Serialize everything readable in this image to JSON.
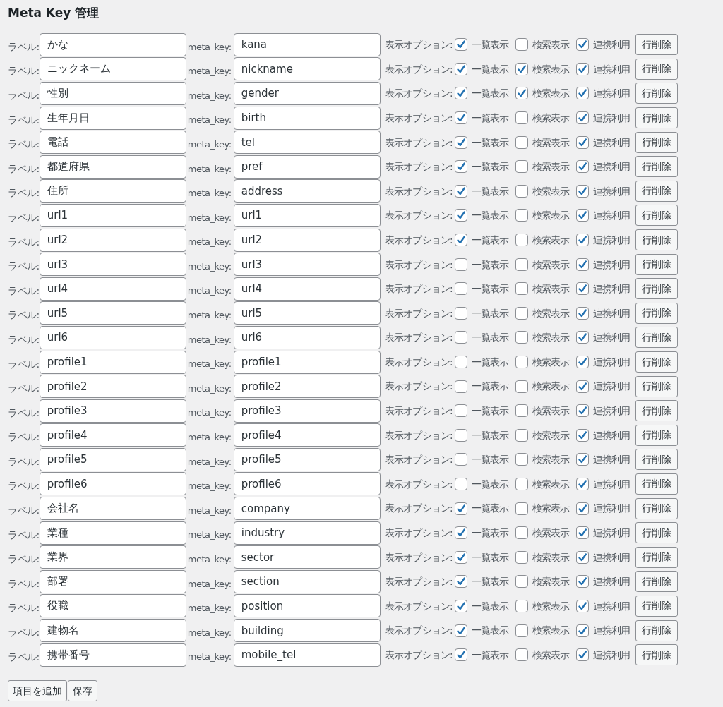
{
  "title": "Meta Key 管理",
  "rows": [
    {
      "label_caption": "ラベル:",
      "label": "かな",
      "key_caption": "meta_key:",
      "key": "kana",
      "options_caption": "表示オプション:",
      "options": [
        {
          "label": "一覧表示",
          "checked": true
        },
        {
          "label": "検索表示",
          "checked": false
        },
        {
          "label": "連携利用",
          "checked": true
        }
      ],
      "delete_button": "行削除"
    },
    {
      "label_caption": "ラベル:",
      "label": "ニックネーム",
      "key_caption": "meta_key:",
      "key": "nickname",
      "options_caption": "表示オプション:",
      "options": [
        {
          "label": "一覧表示",
          "checked": true
        },
        {
          "label": "検索表示",
          "checked": true
        },
        {
          "label": "連携利用",
          "checked": true
        }
      ],
      "delete_button": "行削除"
    },
    {
      "label_caption": "ラベル:",
      "label": "性別",
      "key_caption": "meta_key:",
      "key": "gender",
      "options_caption": "表示オプション:",
      "options": [
        {
          "label": "一覧表示",
          "checked": true
        },
        {
          "label": "検索表示",
          "checked": true
        },
        {
          "label": "連携利用",
          "checked": true
        }
      ],
      "delete_button": "行削除"
    },
    {
      "label_caption": "ラベル:",
      "label": "生年月日",
      "key_caption": "meta_key:",
      "key": "birth",
      "options_caption": "表示オプション:",
      "options": [
        {
          "label": "一覧表示",
          "checked": true
        },
        {
          "label": "検索表示",
          "checked": false
        },
        {
          "label": "連携利用",
          "checked": true
        }
      ],
      "delete_button": "行削除"
    },
    {
      "label_caption": "ラベル:",
      "label": "電話",
      "key_caption": "meta_key:",
      "key": "tel",
      "options_caption": "表示オプション:",
      "options": [
        {
          "label": "一覧表示",
          "checked": true
        },
        {
          "label": "検索表示",
          "checked": false
        },
        {
          "label": "連携利用",
          "checked": true
        }
      ],
      "delete_button": "行削除"
    },
    {
      "label_caption": "ラベル:",
      "label": "都道府県",
      "key_caption": "meta_key:",
      "key": "pref",
      "options_caption": "表示オプション:",
      "options": [
        {
          "label": "一覧表示",
          "checked": true
        },
        {
          "label": "検索表示",
          "checked": false
        },
        {
          "label": "連携利用",
          "checked": true
        }
      ],
      "delete_button": "行削除"
    },
    {
      "label_caption": "ラベル:",
      "label": "住所",
      "key_caption": "meta_key:",
      "key": "address",
      "options_caption": "表示オプション:",
      "options": [
        {
          "label": "一覧表示",
          "checked": true
        },
        {
          "label": "検索表示",
          "checked": false
        },
        {
          "label": "連携利用",
          "checked": true
        }
      ],
      "delete_button": "行削除"
    },
    {
      "label_caption": "ラベル:",
      "label": "url1",
      "key_caption": "meta_key:",
      "key": "url1",
      "options_caption": "表示オプション:",
      "options": [
        {
          "label": "一覧表示",
          "checked": true
        },
        {
          "label": "検索表示",
          "checked": false
        },
        {
          "label": "連携利用",
          "checked": true
        }
      ],
      "delete_button": "行削除"
    },
    {
      "label_caption": "ラベル:",
      "label": "url2",
      "key_caption": "meta_key:",
      "key": "url2",
      "options_caption": "表示オプション:",
      "options": [
        {
          "label": "一覧表示",
          "checked": true
        },
        {
          "label": "検索表示",
          "checked": false
        },
        {
          "label": "連携利用",
          "checked": true
        }
      ],
      "delete_button": "行削除"
    },
    {
      "label_caption": "ラベル:",
      "label": "url3",
      "key_caption": "meta_key:",
      "key": "url3",
      "options_caption": "表示オプション:",
      "options": [
        {
          "label": "一覧表示",
          "checked": false
        },
        {
          "label": "検索表示",
          "checked": false
        },
        {
          "label": "連携利用",
          "checked": true
        }
      ],
      "delete_button": "行削除"
    },
    {
      "label_caption": "ラベル:",
      "label": "url4",
      "key_caption": "meta_key:",
      "key": "url4",
      "options_caption": "表示オプション:",
      "options": [
        {
          "label": "一覧表示",
          "checked": false
        },
        {
          "label": "検索表示",
          "checked": false
        },
        {
          "label": "連携利用",
          "checked": true
        }
      ],
      "delete_button": "行削除"
    },
    {
      "label_caption": "ラベル:",
      "label": "url5",
      "key_caption": "meta_key:",
      "key": "url5",
      "options_caption": "表示オプション:",
      "options": [
        {
          "label": "一覧表示",
          "checked": false
        },
        {
          "label": "検索表示",
          "checked": false
        },
        {
          "label": "連携利用",
          "checked": true
        }
      ],
      "delete_button": "行削除"
    },
    {
      "label_caption": "ラベル:",
      "label": "url6",
      "key_caption": "meta_key:",
      "key": "url6",
      "options_caption": "表示オプション:",
      "options": [
        {
          "label": "一覧表示",
          "checked": false
        },
        {
          "label": "検索表示",
          "checked": false
        },
        {
          "label": "連携利用",
          "checked": true
        }
      ],
      "delete_button": "行削除"
    },
    {
      "label_caption": "ラベル:",
      "label": "profile1",
      "key_caption": "meta_key:",
      "key": "profile1",
      "options_caption": "表示オプション:",
      "options": [
        {
          "label": "一覧表示",
          "checked": false
        },
        {
          "label": "検索表示",
          "checked": false
        },
        {
          "label": "連携利用",
          "checked": true
        }
      ],
      "delete_button": "行削除"
    },
    {
      "label_caption": "ラベル:",
      "label": "profile2",
      "key_caption": "meta_key:",
      "key": "profile2",
      "options_caption": "表示オプション:",
      "options": [
        {
          "label": "一覧表示",
          "checked": false
        },
        {
          "label": "検索表示",
          "checked": false
        },
        {
          "label": "連携利用",
          "checked": true
        }
      ],
      "delete_button": "行削除"
    },
    {
      "label_caption": "ラベル:",
      "label": "profile3",
      "key_caption": "meta_key:",
      "key": "profile3",
      "options_caption": "表示オプション:",
      "options": [
        {
          "label": "一覧表示",
          "checked": false
        },
        {
          "label": "検索表示",
          "checked": false
        },
        {
          "label": "連携利用",
          "checked": true
        }
      ],
      "delete_button": "行削除"
    },
    {
      "label_caption": "ラベル:",
      "label": "profile4",
      "key_caption": "meta_key:",
      "key": "profile4",
      "options_caption": "表示オプション:",
      "options": [
        {
          "label": "一覧表示",
          "checked": false
        },
        {
          "label": "検索表示",
          "checked": false
        },
        {
          "label": "連携利用",
          "checked": true
        }
      ],
      "delete_button": "行削除"
    },
    {
      "label_caption": "ラベル:",
      "label": "profile5",
      "key_caption": "meta_key:",
      "key": "profile5",
      "options_caption": "表示オプション:",
      "options": [
        {
          "label": "一覧表示",
          "checked": false
        },
        {
          "label": "検索表示",
          "checked": false
        },
        {
          "label": "連携利用",
          "checked": true
        }
      ],
      "delete_button": "行削除"
    },
    {
      "label_caption": "ラベル:",
      "label": "profile6",
      "key_caption": "meta_key:",
      "key": "profile6",
      "options_caption": "表示オプション:",
      "options": [
        {
          "label": "一覧表示",
          "checked": false
        },
        {
          "label": "検索表示",
          "checked": false
        },
        {
          "label": "連携利用",
          "checked": true
        }
      ],
      "delete_button": "行削除"
    },
    {
      "label_caption": "ラベル:",
      "label": "会社名",
      "key_caption": "meta_key:",
      "key": "company",
      "options_caption": "表示オプション:",
      "options": [
        {
          "label": "一覧表示",
          "checked": true
        },
        {
          "label": "検索表示",
          "checked": false
        },
        {
          "label": "連携利用",
          "checked": true
        }
      ],
      "delete_button": "行削除"
    },
    {
      "label_caption": "ラベル:",
      "label": "業種",
      "key_caption": "meta_key:",
      "key": "industry",
      "options_caption": "表示オプション:",
      "options": [
        {
          "label": "一覧表示",
          "checked": true
        },
        {
          "label": "検索表示",
          "checked": false
        },
        {
          "label": "連携利用",
          "checked": true
        }
      ],
      "delete_button": "行削除"
    },
    {
      "label_caption": "ラベル:",
      "label": "業界",
      "key_caption": "meta_key:",
      "key": "sector",
      "options_caption": "表示オプション:",
      "options": [
        {
          "label": "一覧表示",
          "checked": true
        },
        {
          "label": "検索表示",
          "checked": false
        },
        {
          "label": "連携利用",
          "checked": true
        }
      ],
      "delete_button": "行削除"
    },
    {
      "label_caption": "ラベル:",
      "label": "部署",
      "key_caption": "meta_key:",
      "key": "section",
      "options_caption": "表示オプション:",
      "options": [
        {
          "label": "一覧表示",
          "checked": true
        },
        {
          "label": "検索表示",
          "checked": false
        },
        {
          "label": "連携利用",
          "checked": true
        }
      ],
      "delete_button": "行削除"
    },
    {
      "label_caption": "ラベル:",
      "label": "役職",
      "key_caption": "meta_key:",
      "key": "position",
      "options_caption": "表示オプション:",
      "options": [
        {
          "label": "一覧表示",
          "checked": true
        },
        {
          "label": "検索表示",
          "checked": false
        },
        {
          "label": "連携利用",
          "checked": true
        }
      ],
      "delete_button": "行削除"
    },
    {
      "label_caption": "ラベル:",
      "label": "建物名",
      "key_caption": "meta_key:",
      "key": "building",
      "options_caption": "表示オプション:",
      "options": [
        {
          "label": "一覧表示",
          "checked": true
        },
        {
          "label": "検索表示",
          "checked": false
        },
        {
          "label": "連携利用",
          "checked": true
        }
      ],
      "delete_button": "行削除"
    },
    {
      "label_caption": "ラベル:",
      "label": "携帯番号",
      "key_caption": "meta_key:",
      "key": "mobile_tel",
      "options_caption": "表示オプション:",
      "options": [
        {
          "label": "一覧表示",
          "checked": true
        },
        {
          "label": "検索表示",
          "checked": false
        },
        {
          "label": "連携利用",
          "checked": true
        }
      ],
      "delete_button": "行削除"
    }
  ],
  "buttons": [
    "項目を追加",
    "保存"
  ]
}
